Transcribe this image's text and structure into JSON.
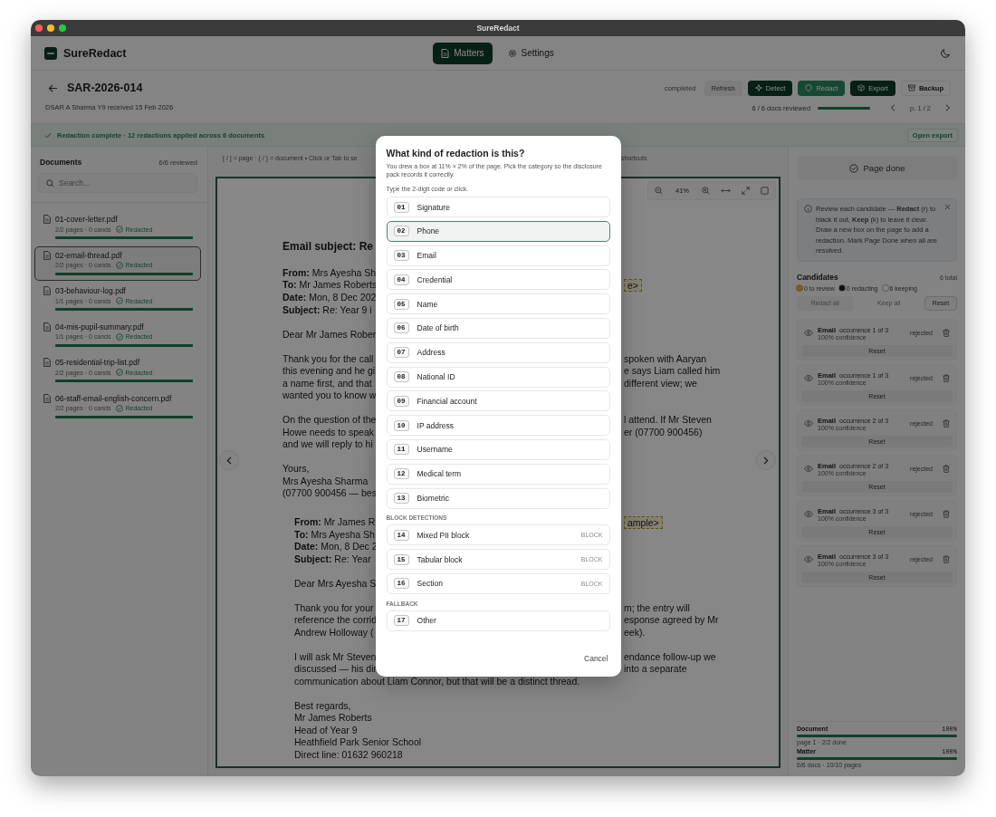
{
  "window": {
    "title": "SureRedact"
  },
  "app_header": {
    "brand": "SureRedact",
    "nav": [
      {
        "label": "Matters",
        "selected": true
      },
      {
        "label": "Settings",
        "selected": false
      }
    ]
  },
  "matter": {
    "title": "SAR-2026-014",
    "subtitle": "DSAR A Sharma Y9 received 15 Feb 2026",
    "status": "completed",
    "actions": [
      {
        "label": "Refresh",
        "kind": "ghost"
      },
      {
        "label": "Detect",
        "kind": "dark"
      },
      {
        "label": "Redact",
        "kind": "accent"
      },
      {
        "label": "Export",
        "kind": "dark"
      },
      {
        "label": "Backup",
        "kind": "outline"
      }
    ],
    "review": {
      "text": "6 / 6 docs reviewed",
      "level": 1
    },
    "page_indicator": "p. 1 / 2"
  },
  "banner": {
    "message": "Redaction complete · 12 redactions applied across 6 documents",
    "action": "Open export"
  },
  "sidebar": {
    "title": "Documents",
    "count": "6/6 reviewed",
    "search": {
      "placeholder": "Search..."
    },
    "documents": [
      {
        "name": "01-cover-letter.pdf",
        "meta": "2/2 pages · 0 cands",
        "status": "Redacted",
        "level": 1,
        "selected": false
      },
      {
        "name": "02-email-thread.pdf",
        "meta": "2/2 pages · 0 cands",
        "status": "Redacted",
        "level": 1,
        "selected": true
      },
      {
        "name": "03-behaviour-log.pdf",
        "meta": "1/1 pages · 0 cands",
        "status": "Redacted",
        "level": 1,
        "selected": false
      },
      {
        "name": "04-mis-pupil-summary.pdf",
        "meta": "1/1 pages · 0 cands",
        "status": "Redacted",
        "level": 1,
        "selected": false
      },
      {
        "name": "05-residential-trip-list.pdf",
        "meta": "2/2 pages · 0 cands",
        "status": "Redacted",
        "level": 1,
        "selected": false
      },
      {
        "name": "06-staff-email-english-concern.pdf",
        "meta": "2/2 pages · 0 cands",
        "status": "Redacted",
        "level": 1,
        "selected": false
      }
    ]
  },
  "viewer": {
    "hint_left": "[ / ] = page · { / } = document • Click or Tab to se",
    "hint_right": "shortcuts",
    "zoom": "41%",
    "lines": [
      {
        "kind": "heading",
        "text": "Email subject: Re"
      },
      {
        "kind": "text",
        "text": "**From:** Mrs Ayesha Sh",
        "space": true
      },
      {
        "kind": "text",
        "text": "**To:** Mr James Roberts",
        "right": "e>",
        "candidate": true
      },
      {
        "kind": "text",
        "text": "**Date:** Mon, 8 Dec 202"
      },
      {
        "kind": "text",
        "text": "**Subject:** Re: Year 9 i"
      },
      {
        "kind": "text",
        "text": "Dear Mr James Rober",
        "space": true
      },
      {
        "kind": "text",
        "text": "Thank you for the call",
        "right": "spoken with Aaryan",
        "space": true
      },
      {
        "kind": "text",
        "text": "this evening and he gi",
        "right": "e says Liam called him"
      },
      {
        "kind": "text",
        "text": "a name first, and that",
        "right": "different view; we"
      },
      {
        "kind": "text",
        "text": "wanted you to know w"
      },
      {
        "kind": "text",
        "text": "On the question of the",
        "right": "l attend. If Mr Steven",
        "space": true
      },
      {
        "kind": "text",
        "text": "Howe needs to speak",
        "right": "er (07700 900456)"
      },
      {
        "kind": "text",
        "text": "and we will reply to hi"
      },
      {
        "kind": "text",
        "text": "Yours,",
        "space": true
      },
      {
        "kind": "text",
        "text": "Mrs Ayesha Sharma"
      },
      {
        "kind": "text",
        "text": "(07700 900456 — bes"
      },
      {
        "kind": "text",
        "text": "**From:** Mr James R",
        "right": "ample>",
        "candidate": true,
        "indent": true,
        "space": true
      },
      {
        "kind": "text",
        "text": "**To:** Mrs Ayesha Sh",
        "indent": true
      },
      {
        "kind": "text",
        "text": "**Date:** Mon, 8 Dec 2",
        "indent": true
      },
      {
        "kind": "text",
        "text": "**Subject:** Re: Year",
        "indent": true
      },
      {
        "kind": "text",
        "text": "Dear Mrs Ayesha S",
        "indent": true,
        "space": true
      },
      {
        "kind": "text",
        "text": "Thank you for your",
        "right": "m; the entry will",
        "indent": true,
        "space": true
      },
      {
        "kind": "text",
        "text": "reference the corrid",
        "right": "esponse agreed by Mr",
        "indent": true
      },
      {
        "kind": "text",
        "text": "Andrew Holloway (",
        "right": "eek).",
        "indent": true
      },
      {
        "kind": "text",
        "text": "I will ask Mr Steven",
        "right": "endance follow-up we",
        "indent": true,
        "space": true
      },
      {
        "kind": "text",
        "text": "discussed — his dir",
        "right": "into a separate",
        "indent": true
      },
      {
        "kind": "full",
        "text": "communication about Liam Connor, but that will be a distinct thread.",
        "indent": true
      },
      {
        "kind": "text",
        "text": "Best regards,",
        "indent": true,
        "space": true
      },
      {
        "kind": "text",
        "text": "Mr James Roberts",
        "indent": true
      },
      {
        "kind": "text",
        "text": "Head of Year 9",
        "indent": true
      },
      {
        "kind": "text",
        "text": "Heathfield Park Senior School",
        "indent": true
      },
      {
        "kind": "text",
        "text": "Direct line: 01632 960218",
        "indent": true
      }
    ]
  },
  "dialog": {
    "title": "What kind of redaction is this?",
    "description": "You drew a box at 11% × 2% of the page. Pick the category so the disclosure pack records it correctly.",
    "hint": "Type the 2-digit code or click.",
    "groups": [
      {
        "options": [
          {
            "code": "01",
            "label": "Signature",
            "selected": false
          },
          {
            "code": "02",
            "label": "Phone",
            "selected": true
          },
          {
            "code": "03",
            "label": "Email",
            "selected": false
          },
          {
            "code": "04",
            "label": "Credential",
            "selected": false
          },
          {
            "code": "05",
            "label": "Name",
            "selected": false
          },
          {
            "code": "06",
            "label": "Date of birth",
            "selected": false
          },
          {
            "code": "07",
            "label": "Address",
            "selected": false
          },
          {
            "code": "08",
            "label": "National ID",
            "selected": false
          },
          {
            "code": "09",
            "label": "Financial account",
            "selected": false
          },
          {
            "code": "10",
            "label": "IP address",
            "selected": false
          },
          {
            "code": "11",
            "label": "Username",
            "selected": false
          },
          {
            "code": "12",
            "label": "Medical term",
            "selected": false
          },
          {
            "code": "13",
            "label": "Biometric",
            "selected": false
          }
        ]
      },
      {
        "heading": "BLOCK DETECTIONS",
        "options": [
          {
            "code": "14",
            "label": "Mixed PII block",
            "tag": "BLOCK",
            "selected": false
          },
          {
            "code": "15",
            "label": "Tabular block",
            "tag": "BLOCK",
            "selected": false
          },
          {
            "code": "16",
            "label": "Section",
            "tag": "BLOCK",
            "selected": false
          }
        ]
      },
      {
        "heading": "FALLBACK",
        "options": [
          {
            "code": "17",
            "label": "Other",
            "selected": false
          }
        ]
      }
    ],
    "cancel": "Cancel"
  },
  "panel": {
    "page_done": "Page done",
    "tip": "Review each candidate — **Redact** (r) to black it out, **Keep** (k) to leave it clear. Draw a new box on the page to add a redaction. Mark Page Done when all are resolved.",
    "candidates_title": "Candidates",
    "total": "6 total",
    "legend": [
      {
        "label": "0 to review",
        "color": "#7b6213"
      },
      {
        "label": "0 redacting",
        "color": "#101010"
      },
      {
        "label": "6 keeping",
        "color": "#878787"
      }
    ],
    "bulk": [
      {
        "label": "Redact all",
        "disabled": true
      },
      {
        "label": "Keep all",
        "disabled": true
      },
      {
        "label": "Reset",
        "disabled": false
      }
    ],
    "candidates": [
      {
        "type": "Email",
        "occurrence": "occurrence 1 of 3",
        "confidence": "100% confidence",
        "status": "rejected",
        "action": "Reset"
      },
      {
        "type": "Email",
        "occurrence": "occurrence 1 of 3",
        "confidence": "100% confidence",
        "status": "rejected",
        "action": "Reset"
      },
      {
        "type": "Email",
        "occurrence": "occurrence 2 of 3",
        "confidence": "100% confidence",
        "status": "rejected",
        "action": "Reset"
      },
      {
        "type": "Email",
        "occurrence": "occurrence 2 of 3",
        "confidence": "100% confidence",
        "status": "rejected",
        "action": "Reset"
      },
      {
        "type": "Email",
        "occurrence": "occurrence 3 of 3",
        "confidence": "100% confidence",
        "status": "rejected",
        "action": "Reset"
      },
      {
        "type": "Email",
        "occurrence": "occurrence 3 of 3",
        "confidence": "100% confidence",
        "status": "rejected",
        "action": "Reset"
      }
    ],
    "progress": [
      {
        "label": "Document",
        "value": "100%",
        "level": 1,
        "detail": "page 1 · 2/2 done"
      },
      {
        "label": "Matter",
        "value": "100%",
        "level": 1,
        "detail": "6/6 docs · 10/10 pages"
      }
    ]
  }
}
